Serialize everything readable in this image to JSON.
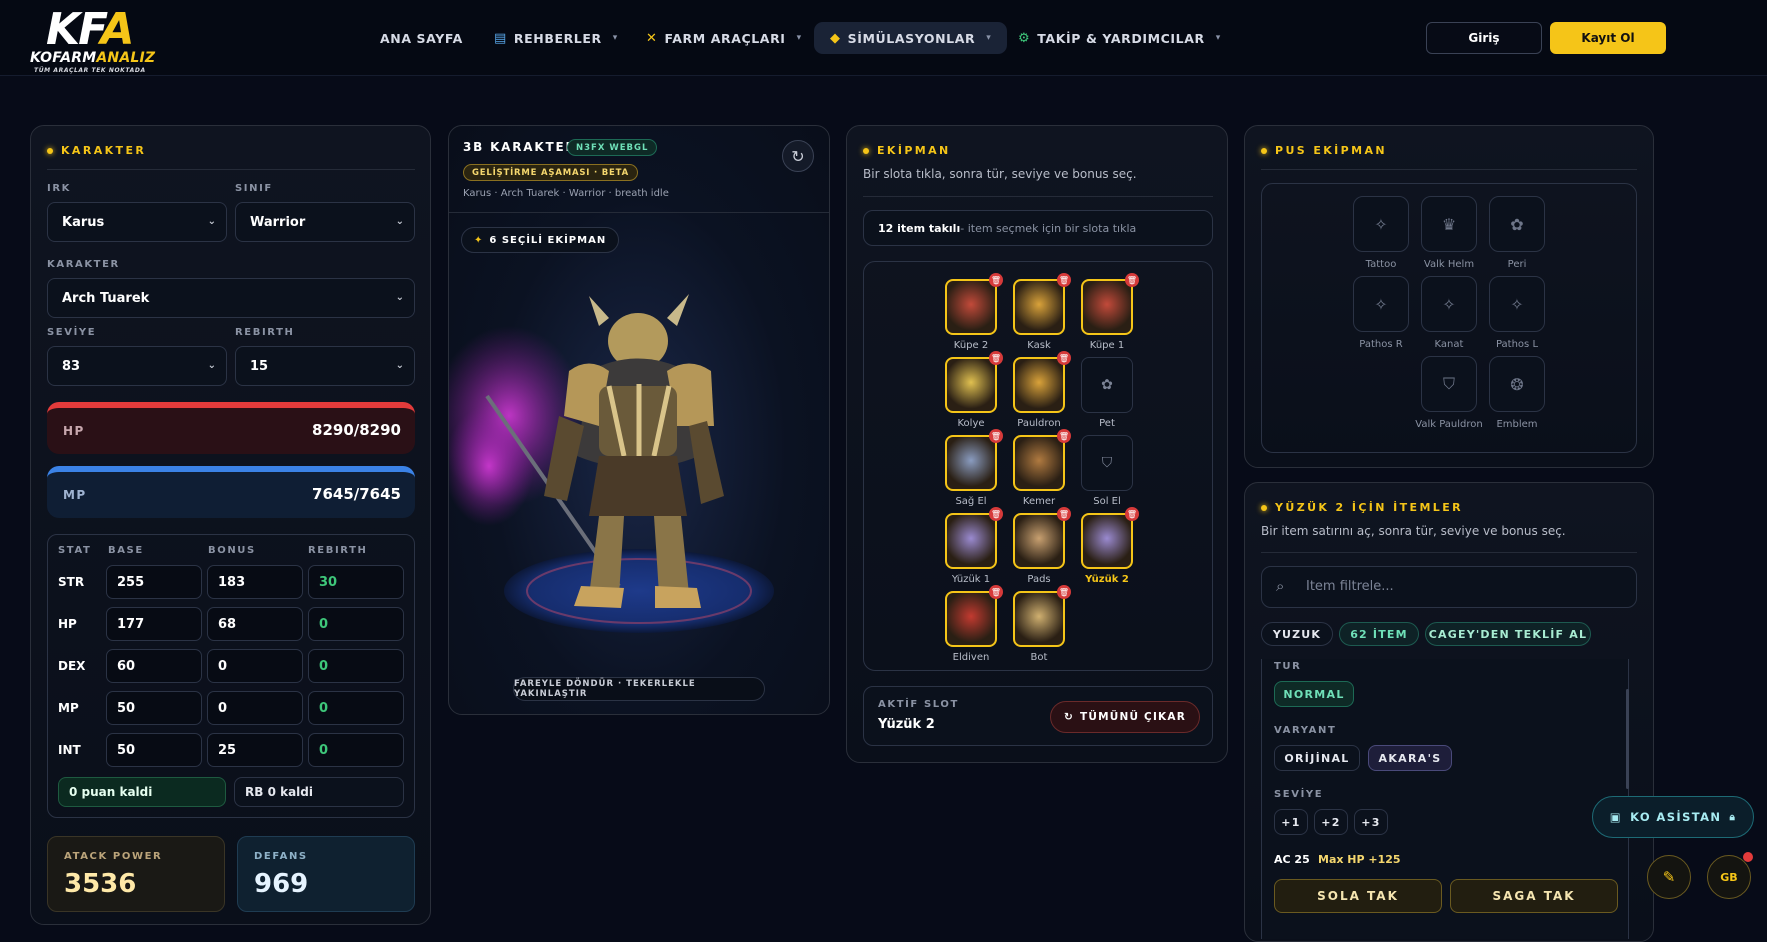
{
  "header": {
    "logo": {
      "k": "KF",
      "a": "A",
      "brand_a": "KOFARM",
      "brand_b": "ANALIZ",
      "tagline": "TÜM ARAÇLAR TEK NOKTADA"
    },
    "nav": [
      {
        "label": "ANA SAYFA",
        "icon": ""
      },
      {
        "label": "REHBERLER",
        "icon": "document-icon"
      },
      {
        "label": "FARM ARAÇLARI",
        "icon": "swords-icon"
      },
      {
        "label": "SİMÜLASYONLAR",
        "icon": "diamond-icon"
      },
      {
        "label": "TAKİP & YARDIMCILAR",
        "icon": "gear-icon"
      }
    ],
    "login": "Giriş",
    "register": "Kayıt Ol"
  },
  "character": {
    "title": "KARAKTER",
    "race_label": "IRK",
    "race": "Karus",
    "class_label": "SINIF",
    "class": "Warrior",
    "char_label": "KARAKTER",
    "char": "Arch Tuarek",
    "level_label": "SEVİYE",
    "level": "83",
    "rebirth_label": "REBIRTH",
    "rebirth": "15",
    "hp_label": "HP",
    "hp": "8290/8290",
    "mp_label": "MP",
    "mp": "7645/7645",
    "stat_headers": [
      "STAT",
      "BASE",
      "BONUS",
      "REBIRTH"
    ],
    "stats": [
      {
        "name": "STR",
        "base": "255",
        "bonus": "183",
        "rebirth": "30"
      },
      {
        "name": "HP",
        "base": "177",
        "bonus": "68",
        "rebirth": "0"
      },
      {
        "name": "DEX",
        "base": "60",
        "bonus": "0",
        "rebirth": "0"
      },
      {
        "name": "MP",
        "base": "50",
        "bonus": "0",
        "rebirth": "0"
      },
      {
        "name": "INT",
        "base": "50",
        "bonus": "25",
        "rebirth": "0"
      }
    ],
    "points_left": "0 puan kaldi",
    "rb_left": "RB 0 kaldi",
    "attack_label": "ATACK POWER",
    "attack": "3536",
    "defense_label": "DEFANS",
    "defense": "969"
  },
  "viewer": {
    "title": "3B KARAKTER",
    "engine_badge": "N3FX WEBGL",
    "beta_badge": "GELİŞTİRME AŞAMASI · BETA",
    "subtitle": "Karus · Arch Tuarek · Warrior · breath idle",
    "equipped": "6 SEÇİLİ EKİPMAN",
    "hint": "FAREYLE DÖNDÜR · TEKERLEKLE YAKINLAŞTIR"
  },
  "equipment": {
    "title": "EKİPMAN",
    "desc": "Bir slota tıkla, sonra tür, seviye ve bonus seç.",
    "count_strong": "12 item takılı",
    "count_rest": " - item seçmek için bir slota tıkla",
    "slots": [
      {
        "name": "Küpe 2",
        "filled": true,
        "color": "#c24a3a"
      },
      {
        "name": "Kask",
        "filled": true,
        "color": "#d9a23a"
      },
      {
        "name": "Küpe 1",
        "filled": true,
        "color": "#c24a3a"
      },
      {
        "name": "Kolye",
        "filled": true,
        "color": "#e0c050"
      },
      {
        "name": "Pauldron",
        "filled": true,
        "color": "#d9a23a"
      },
      {
        "name": "Pet",
        "filled": false,
        "color": ""
      },
      {
        "name": "Sağ El",
        "filled": true,
        "color": "#8a9cc0"
      },
      {
        "name": "Kemer",
        "filled": true,
        "color": "#b07a40"
      },
      {
        "name": "Sol El",
        "filled": false,
        "color": ""
      },
      {
        "name": "Yüzük 1",
        "filled": true,
        "color": "#9a8ad0"
      },
      {
        "name": "Pads",
        "filled": true,
        "color": "#c8a070"
      },
      {
        "name": "Yüzük 2",
        "filled": true,
        "color": "#9a8ad0"
      },
      {
        "name": "Eldiven",
        "filled": true,
        "color": "#c23a30"
      },
      {
        "name": "Bot",
        "filled": true,
        "color": "#d0b070"
      }
    ],
    "active_label": "AKTİF SLOT",
    "active_slot": "Yüzük 2",
    "remove_all": "TÜMÜNÜ ÇIKAR"
  },
  "pus": {
    "title": "PUS EKİPMAN",
    "items": [
      {
        "name": "Tattoo",
        "icon": "sparkle-icon"
      },
      {
        "name": "Valk Helm",
        "icon": "crown-icon"
      },
      {
        "name": "Peri",
        "icon": "paw-icon"
      },
      {
        "name": "Pathos R",
        "icon": "sparkle-icon"
      },
      {
        "name": "Kanat",
        "icon": "sparkle-icon"
      },
      {
        "name": "Pathos L",
        "icon": "sparkle-icon"
      },
      {
        "name": "Valk Pauldron",
        "icon": "shield-icon"
      },
      {
        "name": "Emblem",
        "icon": "medal-icon"
      }
    ]
  },
  "ring": {
    "title": "YÜZÜK 2 İÇİN İTEMLER",
    "desc": "Bir item satırını aç, sonra tür, seviye ve bonus seç.",
    "search_placeholder": "Item filtrele...",
    "chips": [
      "YUZUK",
      "62 İTEM",
      "CAGEY'DEN TEKLİF AL"
    ],
    "type_label": "TUR",
    "type": "NORMAL",
    "variant_label": "VARYANT",
    "variants": [
      "ORİJİNAL",
      "AKARA'S"
    ],
    "level_label": "SEVİYE",
    "levels": [
      "+1",
      "+2",
      "+3"
    ],
    "stat_ac": "AC 25",
    "stat_hp": "Max HP +125",
    "left_btn": "SOLA TAK",
    "right_btn": "SAGA TAK"
  },
  "assistant": {
    "label": "KO ASİSTAN",
    "avatar": "GB"
  }
}
